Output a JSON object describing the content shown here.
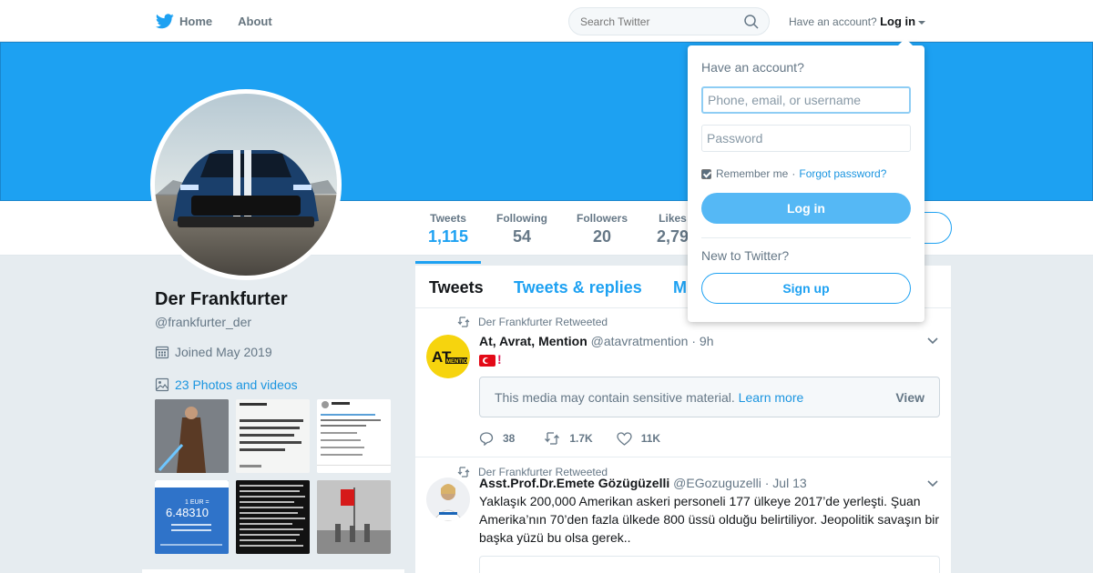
{
  "nav": {
    "home_label": "Home",
    "about_label": "About",
    "search_placeholder": "Search Twitter",
    "have_account": "Have an account?",
    "login_label": "Log in"
  },
  "colors": {
    "brand": "#1da1f2",
    "link": "#1b95e0",
    "muted": "#657786"
  },
  "stats": {
    "tweets_label": "Tweets",
    "tweets_value": "1,115",
    "following_label": "Following",
    "following_value": "54",
    "followers_label": "Followers",
    "followers_value": "20",
    "likes_label": "Likes",
    "likes_value": "2,79"
  },
  "profile": {
    "name": "Der Frankfurter",
    "handle": "@frankfurter_der",
    "joined": "Joined May 2019",
    "photos_link": "23 Photos and videos"
  },
  "timeline": {
    "tabs": [
      "Tweets",
      "Tweets & replies",
      "M"
    ],
    "tweets": [
      {
        "retweet_line": "Der Frankfurter Retweeted",
        "author": "At, Avrat, Mention",
        "handle": "@atavratmention",
        "time": "· 9h",
        "text_suffix": "!",
        "sensitive_msg": "This media may contain sensitive material.",
        "learn_more": "Learn more",
        "view": "View",
        "replies": "38",
        "retweets": "1.7K",
        "likes": "11K"
      },
      {
        "retweet_line": "Der Frankfurter Retweeted",
        "author": "Asst.Prof.Dr.Emete Gözügüzelli",
        "handle": "@EGozuguzelli",
        "time": "· Jul 13",
        "text": "Yaklaşık 200,000 Amerikan askeri personeli 177 ülkeye 2017’de yerleşti. Şuan Amerika’nın 70’den fazla ülkede 800 üssü olduğu belirtiliyor. Jeopolitik savaşın bir başka yüzü bu olsa gerek.."
      }
    ]
  },
  "login_dropdown": {
    "title": "Have an account?",
    "username_placeholder": "Phone, email, or username",
    "password_placeholder": "Password",
    "remember": "Remember me",
    "separator": "·",
    "forgot": "Forgot password?",
    "login_button": "Log in",
    "new_to": "New to Twitter?",
    "signup_button": "Sign up"
  }
}
